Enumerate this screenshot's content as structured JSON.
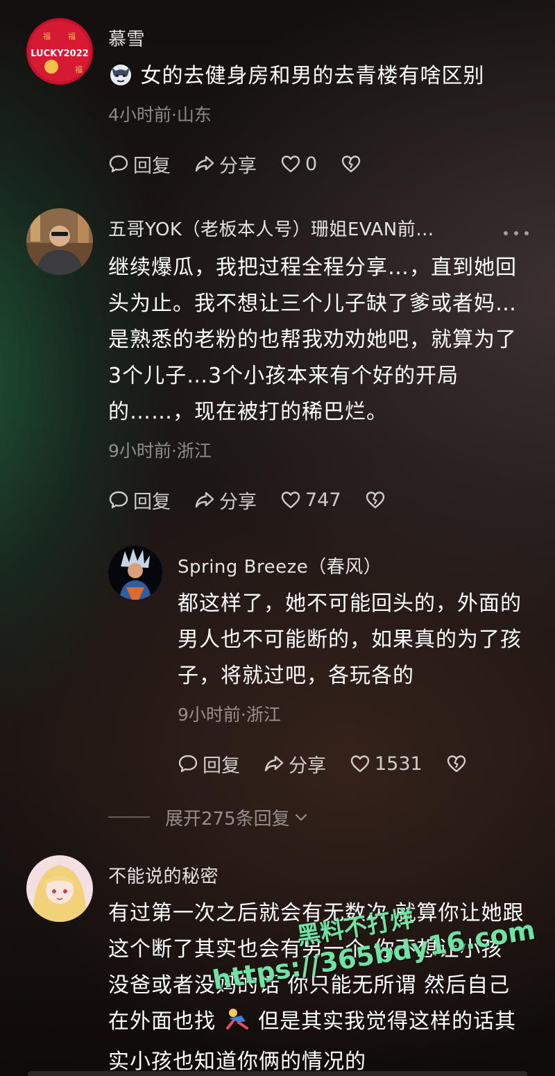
{
  "comments": [
    {
      "username": "慕雪",
      "text_lines": [
        "女的去健身房和男的去青楼有啥区别"
      ],
      "meta": "4小时前·山东",
      "reply_label": "回复",
      "share_label": "分享",
      "likes": "0",
      "avatar_text": "LUCKY2022"
    },
    {
      "username": "五哥YOK（老板本人号）珊姐EVAN前…",
      "text_lines": [
        "继续爆瓜，我把过程全程分享…，直到她回",
        "头为止。我不想让三个儿子缺了爹或者妈…",
        "是熟悉的老粉的也帮我劝劝她吧，就算为了",
        "3个儿子…3个小孩本来有个好的开局",
        "的……，现在被打的稀巴烂。"
      ],
      "meta": "9小时前·浙江",
      "reply_label": "回复",
      "share_label": "分享",
      "likes": "747"
    },
    {
      "username": "Spring Breeze（春风）",
      "text_lines": [
        "都这样了，她不可能回头的，外面的",
        "男人也不可能断的，如果真的为了孩",
        "子，将就过吧，各玩各的"
      ],
      "meta": "9小时前·浙江",
      "reply_label": "回复",
      "share_label": "分享",
      "likes": "1531"
    },
    {
      "username": "不能说的秘密",
      "text_lines": [
        "有过第一次之后就会有无数次 就算你让她跟",
        "这个断了其实也会有另一个 你不想让小孩",
        "没爸或者没妈的话 你只能无所谓 然后自己",
        "在外面也找",
        "但是其实我觉得这样的话其",
        "实小孩也知道你俩的情况的"
      ]
    }
  ],
  "expand_replies": "展开275条回复",
  "watermark": {
    "line1": "黑料不打烊",
    "line2": "https://365bdy16.com"
  },
  "colors": {
    "text": "#ffffff",
    "meta": "#8a8583",
    "watermark": "#6fe3a3"
  }
}
